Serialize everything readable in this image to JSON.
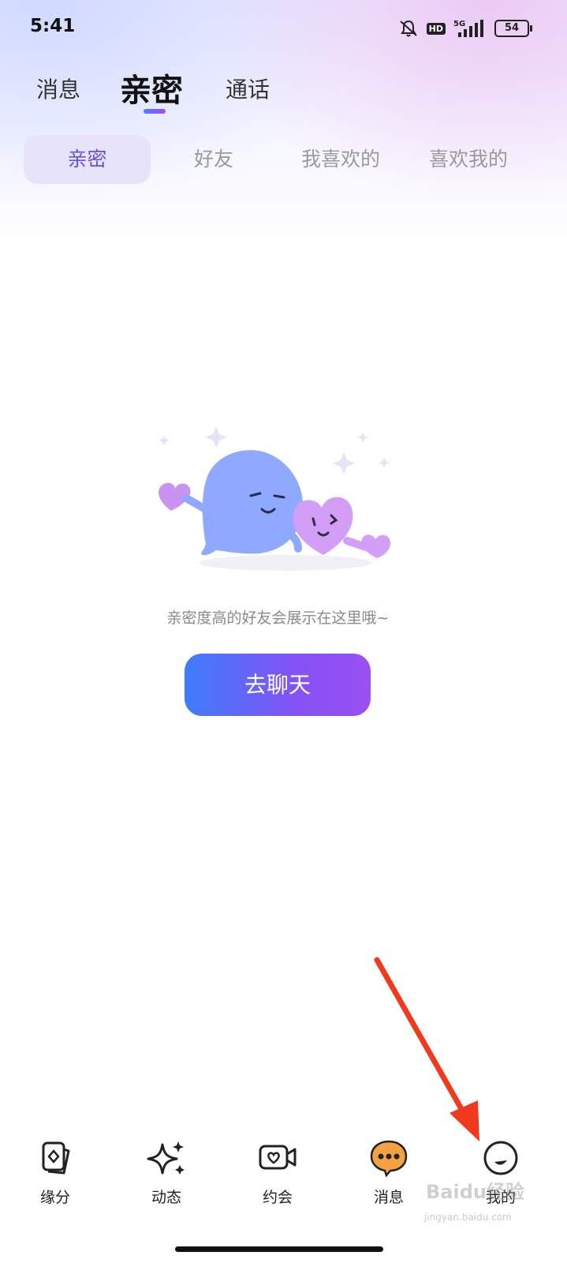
{
  "status_bar": {
    "time": "5:41",
    "network": "5G",
    "hd": "HD",
    "battery": "54"
  },
  "main_tabs": [
    {
      "label": "消息"
    },
    {
      "label": "亲密"
    },
    {
      "label": "通话"
    }
  ],
  "sub_tabs": [
    {
      "label": "亲密"
    },
    {
      "label": "好友"
    },
    {
      "label": "我喜欢的"
    },
    {
      "label": "喜欢我的"
    }
  ],
  "empty_state": {
    "message": "亲密度高的好友会展示在这里哦~",
    "button_label": "去聊天"
  },
  "bottom_nav": [
    {
      "label": "缘分",
      "icon": "cards-icon"
    },
    {
      "label": "动态",
      "icon": "sparkle-icon"
    },
    {
      "label": "约会",
      "icon": "video-heart-icon"
    },
    {
      "label": "消息",
      "icon": "chat-bubble-icon"
    },
    {
      "label": "我的",
      "icon": "face-icon"
    }
  ],
  "watermark": {
    "brand": "Baidu经验",
    "url": "jingyan.baidu.com"
  },
  "colors": {
    "accent": "#6a4fd8",
    "button_start": "#3e7dfc",
    "button_end": "#9a4ff2",
    "arrow": "#f03a1e",
    "message_icon": "#f5a142"
  }
}
